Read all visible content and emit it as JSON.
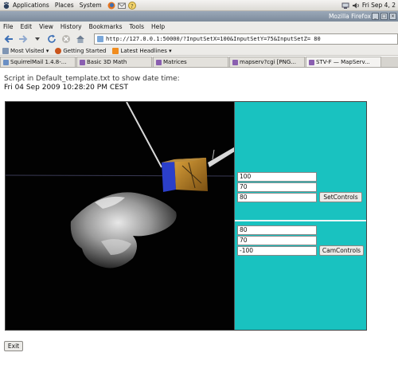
{
  "panel": {
    "menus": [
      "Applications",
      "Places",
      "System"
    ],
    "clock": "Fri Sep  4, 2"
  },
  "window": {
    "title": "Mozilla Firefox"
  },
  "menubar": {
    "items": [
      "File",
      "Edit",
      "View",
      "History",
      "Bookmarks",
      "Tools",
      "Help"
    ]
  },
  "nav": {
    "url": "http://127.0.0.1:50000/?InputSetX=100&InputSetY=75&InputSetZ= 80"
  },
  "bookmarks": {
    "items": [
      "Most Visited ▾",
      "Getting Started",
      "Latest Headlines ▾"
    ]
  },
  "tabs": [
    "SquirrelMail 1.4.8-...",
    "Basic 3D Math",
    "Matrices",
    "mapserv?cgi [PNG...",
    "STV-F — MapServ..."
  ],
  "page": {
    "line1": "Script in Default_template.txt to show date time:",
    "line2": "Fri 04 Sep 2009 10:28:20 PM CEST"
  },
  "set_controls": {
    "x": "100",
    "y": "70",
    "z": " 80",
    "button": "SetControls"
  },
  "cam_controls": {
    "x": "80",
    "y": "70",
    "z": "-100",
    "button": "CamControls"
  },
  "exit": "Exit",
  "colors": {
    "control_panel": "#19c2c0",
    "viewer_bg": "#020202"
  }
}
